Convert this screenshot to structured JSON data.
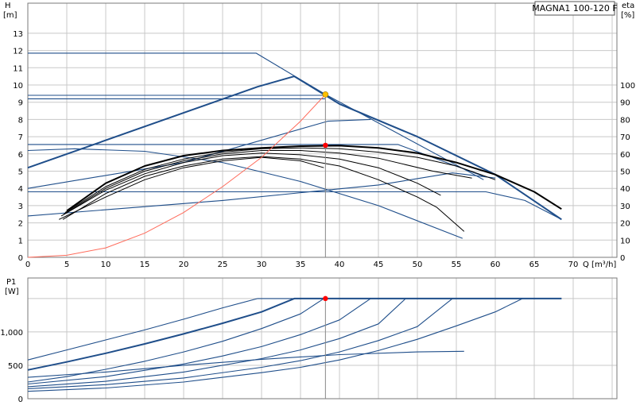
{
  "title": "MAGNA1 100-120 F",
  "colors": {
    "curve": "#1f4e8a",
    "efficiency": "#000000",
    "system": "#ff6a5a",
    "dutypoint": "#ff0000",
    "bestpoint": "#ffc000",
    "grid": "#c8c8c8"
  },
  "chart_data": [
    {
      "type": "line",
      "name": "head",
      "ylabel_top": "H",
      "ylabel_unit": "[m]",
      "y2label_top": "eta",
      "y2label_unit": "[%]",
      "xlabel": "Q [m³/h]",
      "xlim": [
        0,
        70
      ],
      "ylim": [
        0,
        14
      ],
      "y2lim": [
        0,
        140
      ],
      "xticks": [
        "0",
        "5",
        "10",
        "15",
        "20",
        "25",
        "30",
        "35",
        "40",
        "45",
        "50",
        "55",
        "60",
        "65",
        "70"
      ],
      "yticks": [
        "0",
        "1",
        "2",
        "3",
        "4",
        "5",
        "6",
        "7",
        "8",
        "9",
        "10",
        "11",
        "12",
        "13"
      ],
      "y2ticks": [
        "0",
        "10",
        "20",
        "30",
        "40",
        "50",
        "60",
        "70",
        "80",
        "90",
        "100"
      ],
      "grid": true,
      "pump_curves": [
        {
          "name": "max",
          "points": [
            [
              0,
              5.2
            ],
            [
              29.5,
              9.9
            ],
            [
              34.2,
              10.5
            ],
            [
              40,
              8.9
            ],
            [
              50,
              7.0
            ],
            [
              60,
              4.8
            ],
            [
              68.5,
              2.2
            ]
          ],
          "thick": true
        },
        {
          "name": "p1",
          "points": [
            [
              0,
              11.85
            ],
            [
              29.3,
              11.85
            ],
            [
              38.2,
              9.45
            ],
            [
              58.5,
              4.5
            ]
          ]
        },
        {
          "name": "p2",
          "points": [
            [
              0,
              9.4
            ],
            [
              38.2,
              9.4
            ]
          ]
        },
        {
          "name": "p3",
          "points": [
            [
              0,
              9.2
            ],
            [
              38.2,
              9.2
            ]
          ]
        },
        {
          "name": "p4",
          "points": [
            [
              0,
              6.55
            ],
            [
              47.5,
              6.55
            ],
            [
              58.5,
              4.7
            ]
          ]
        },
        {
          "name": "p5",
          "points": [
            [
              0,
              3.8
            ],
            [
              58.8,
              3.8
            ],
            [
              63.8,
              3.3
            ],
            [
              68.5,
              2.2
            ]
          ]
        },
        {
          "name": "p6",
          "points": [
            [
              0,
              4.0
            ],
            [
              20,
              5.5
            ],
            [
              38.5,
              7.9
            ],
            [
              44,
              8.0
            ]
          ]
        },
        {
          "name": "p7",
          "points": [
            [
              0,
              2.4
            ],
            [
              25,
              3.3
            ],
            [
              45,
              4.2
            ],
            [
              54.5,
              4.9
            ],
            [
              60,
              4.6
            ]
          ]
        },
        {
          "name": "p8",
          "points": [
            [
              0,
              6.2
            ],
            [
              6,
              6.3
            ],
            [
              15,
              6.15
            ],
            [
              25,
              5.5
            ],
            [
              35,
              4.4
            ],
            [
              45,
              3.0
            ],
            [
              55.8,
              1.1
            ]
          ]
        }
      ],
      "efficiency_curves": [
        {
          "name": "e_max",
          "points": [
            [
              5,
              27
            ],
            [
              10,
              43
            ],
            [
              15,
              53
            ],
            [
              20,
              59
            ],
            [
              25,
              62
            ],
            [
              30,
              63.5
            ],
            [
              35,
              64.5
            ],
            [
              40,
              64.8
            ],
            [
              45,
              63.5
            ],
            [
              50,
              60.5
            ],
            [
              55,
              55
            ],
            [
              60,
              48
            ],
            [
              65,
              38
            ],
            [
              68.5,
              28
            ]
          ],
          "thick": true
        },
        {
          "name": "e1",
          "points": [
            [
              4.8,
              26
            ],
            [
              10,
              41
            ],
            [
              15,
              51
            ],
            [
              20,
              57
            ],
            [
              25,
              61
            ],
            [
              30,
              63
            ],
            [
              35,
              63.5
            ],
            [
              40,
              63
            ],
            [
              45,
              61
            ],
            [
              50,
              58
            ],
            [
              55,
              53
            ],
            [
              60,
              45
            ]
          ]
        },
        {
          "name": "e2",
          "points": [
            [
              4.6,
              25
            ],
            [
              10,
              40
            ],
            [
              15,
              50
            ],
            [
              20,
              56
            ],
            [
              25,
              60
            ],
            [
              30,
              62
            ],
            [
              35,
              62
            ],
            [
              40,
              60.5
            ],
            [
              45,
              57.5
            ],
            [
              52,
              50
            ],
            [
              57,
              46
            ]
          ]
        },
        {
          "name": "e3",
          "points": [
            [
              4.3,
              24
            ],
            [
              10,
              39
            ],
            [
              15,
              48.5
            ],
            [
              20,
              55
            ],
            [
              25,
              59
            ],
            [
              30,
              60.5
            ],
            [
              35,
              59.5
            ],
            [
              40,
              57
            ],
            [
              45,
              52
            ],
            [
              50,
              43
            ],
            [
              53,
              36
            ]
          ]
        },
        {
          "name": "e4",
          "points": [
            [
              4.5,
              22
            ],
            [
              10,
              37
            ],
            [
              15,
              47
            ],
            [
              20,
              53
            ],
            [
              25,
              57
            ],
            [
              30,
              58.5
            ],
            [
              35,
              57
            ],
            [
              40,
              53
            ],
            [
              45,
              45
            ],
            [
              50,
              35
            ],
            [
              52.5,
              29
            ],
            [
              56,
              15
            ]
          ]
        },
        {
          "name": "e5",
          "points": [
            [
              4.0,
              22
            ],
            [
              10,
              35
            ],
            [
              15,
              45
            ],
            [
              20,
              52
            ],
            [
              25,
              56
            ],
            [
              30,
              58
            ],
            [
              35,
              56
            ],
            [
              38,
              52
            ]
          ]
        }
      ],
      "system_curve": {
        "points": [
          [
            0,
            0
          ],
          [
            5,
            0.12
          ],
          [
            10,
            0.55
          ],
          [
            15,
            1.4
          ],
          [
            20,
            2.6
          ],
          [
            25,
            4.1
          ],
          [
            30,
            5.8
          ],
          [
            35,
            7.9
          ],
          [
            38.2,
            9.45
          ]
        ]
      },
      "duty_point": {
        "x": 38.2,
        "y": 6.5
      },
      "best_point": {
        "x": 38.2,
        "y": 9.45
      },
      "duty_line": {
        "x": 38.2
      }
    },
    {
      "type": "line",
      "name": "power",
      "ylabel_top": "P1",
      "ylabel_unit": "[W]",
      "xlim": [
        0,
        70
      ],
      "ylim": [
        0,
        1600
      ],
      "yticks": [
        "0",
        "500",
        "1,000"
      ],
      "ytick_values": [
        0,
        500,
        1000
      ],
      "grid": true,
      "curves": [
        {
          "name": "q1",
          "points": [
            [
              0,
              580
            ],
            [
              5,
              730
            ],
            [
              10,
              880
            ],
            [
              15,
              1030
            ],
            [
              20,
              1190
            ],
            [
              25,
              1360
            ],
            [
              29.5,
              1500
            ],
            [
              68.5,
              1500
            ]
          ]
        },
        {
          "name": "q2",
          "points": [
            [
              0,
              430
            ],
            [
              5,
              550
            ],
            [
              10,
              680
            ],
            [
              15,
              820
            ],
            [
              20,
              970
            ],
            [
              25,
              1130
            ],
            [
              30,
              1300
            ],
            [
              34.2,
              1500
            ],
            [
              68.5,
              1500
            ]
          ],
          "thick": true
        },
        {
          "name": "q3",
          "points": [
            [
              0,
              250
            ],
            [
              5,
              330
            ],
            [
              10,
              440
            ],
            [
              15,
              560
            ],
            [
              20,
              700
            ],
            [
              25,
              860
            ],
            [
              30,
              1050
            ],
            [
              35,
              1270
            ],
            [
              38,
              1500
            ],
            [
              44,
              1500
            ]
          ]
        },
        {
          "name": "q4",
          "points": [
            [
              0,
              220
            ],
            [
              10,
              330
            ],
            [
              20,
              520
            ],
            [
              25,
              640
            ],
            [
              30,
              780
            ],
            [
              35,
              960
            ],
            [
              40,
              1180
            ],
            [
              44,
              1500
            ]
          ]
        },
        {
          "name": "q5",
          "points": [
            [
              0,
              180
            ],
            [
              10,
              260
            ],
            [
              20,
              400
            ],
            [
              30,
              600
            ],
            [
              35,
              730
            ],
            [
              40,
              900
            ],
            [
              45,
              1120
            ],
            [
              48.5,
              1500
            ]
          ]
        },
        {
          "name": "q6",
          "points": [
            [
              0,
              150
            ],
            [
              10,
              210
            ],
            [
              20,
              310
            ],
            [
              30,
              470
            ],
            [
              35,
              570
            ],
            [
              40,
              700
            ],
            [
              45,
              870
            ],
            [
              50,
              1080
            ],
            [
              54.5,
              1500
            ]
          ]
        },
        {
          "name": "q7",
          "points": [
            [
              0,
              110
            ],
            [
              10,
              160
            ],
            [
              20,
              250
            ],
            [
              30,
              390
            ],
            [
              35,
              470
            ],
            [
              40,
              580
            ],
            [
              45,
              720
            ],
            [
              50,
              890
            ],
            [
              55,
              1090
            ],
            [
              60,
              1300
            ],
            [
              63.5,
              1500
            ]
          ]
        },
        {
          "name": "q8",
          "points": [
            [
              0,
              320
            ],
            [
              10,
              400
            ],
            [
              20,
              500
            ],
            [
              30,
              590
            ],
            [
              40,
              660
            ],
            [
              50,
              700
            ],
            [
              56,
              710
            ]
          ]
        }
      ],
      "duty_point": {
        "x": 38.2,
        "y": 1500
      },
      "duty_line": {
        "x": 38.2
      }
    }
  ]
}
